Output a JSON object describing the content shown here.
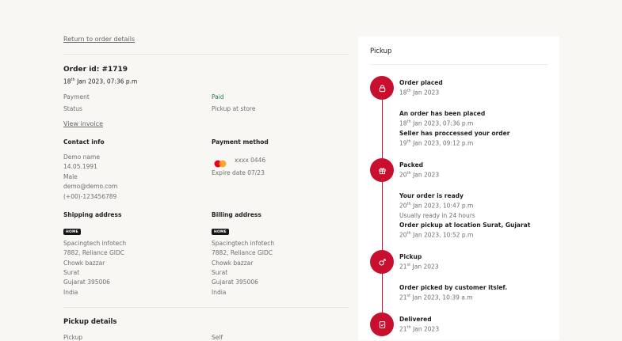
{
  "back_link": "Return to order details",
  "order": {
    "id_label": "Order id: #1719",
    "date_day": "18",
    "date_sup": "th",
    "date_rest": " Jan 2023, 07:36 p.m",
    "payment_label": "Payment",
    "payment_value": "Paid",
    "status_label": "Status",
    "status_value": "Pickup at store",
    "view_invoice": "View invoice"
  },
  "contact": {
    "heading": "Contact info",
    "name": "Demo name",
    "dob": "14.05.1991",
    "gender": "Male",
    "email": "demo@demo.com",
    "phone": "(+00)-123456789"
  },
  "payment_method": {
    "heading": "Payment method",
    "card": "xxxx 0446",
    "expire": "Expire date 07/23"
  },
  "shipping": {
    "heading": "Shipping address",
    "badge": "HOME",
    "lines": [
      "Spacingtech infotech",
      "7882, Reliance GIDC",
      "Chowk bazzar",
      "Surat",
      "Gujarat 395006",
      "India"
    ]
  },
  "billing": {
    "heading": "Billing address",
    "badge": "HOME",
    "lines": [
      "Spacingtech infotech",
      "7882, Reliance GIDC",
      "Chowk bazzar",
      "Surat",
      "Gujarat 395006",
      "India"
    ]
  },
  "pickup_details": {
    "heading": "Pickup details",
    "label": "Pickup",
    "value": "Self"
  },
  "timeline": {
    "title": "Pickup",
    "accent": "#c8102e",
    "events": [
      {
        "title": "Order placed",
        "day": "18",
        "sup": "th",
        "rest": " Jan 2023",
        "icon": "lock-icon"
      },
      {
        "title": "An order has been placed",
        "day": "18",
        "sup": "th",
        "rest": " Jan 2023, 07:36 p.m"
      },
      {
        "title": "Seller has proccessed your order",
        "day": "19",
        "sup": "th",
        "rest": " Jan 2023, 09:12 p.m"
      },
      {
        "title": "Packed",
        "day": "20",
        "sup": "th",
        "rest": " Jan 2023",
        "icon": "gift-icon"
      },
      {
        "title": "Your order is ready",
        "day": "20",
        "sup": "th",
        "rest": " Jan 2023, 10:47 p.m"
      },
      {
        "note": "Usually ready in 24 hours"
      },
      {
        "title": "Order pickup at location Surat, Gujarat",
        "day": "20",
        "sup": "th",
        "rest": " Jan 2023, 10:52 p.m"
      },
      {
        "title": "Pickup",
        "day": "21",
        "sup": "st",
        "rest": " Jan 2023",
        "icon": "person-icon"
      },
      {
        "title": "Order picked by customer itslef.",
        "day": "21",
        "sup": "st",
        "rest": " Jan 2023, 10:39 a.m"
      },
      {
        "title": "Delivered",
        "day": "21",
        "sup": "th",
        "rest": " Jan 2023",
        "icon": "check-doc-icon"
      }
    ]
  },
  "colors": {
    "paid": "#2e7d4f",
    "accent": "#c8102e",
    "background": "#f8f7f4",
    "panel": "#ffffff"
  }
}
